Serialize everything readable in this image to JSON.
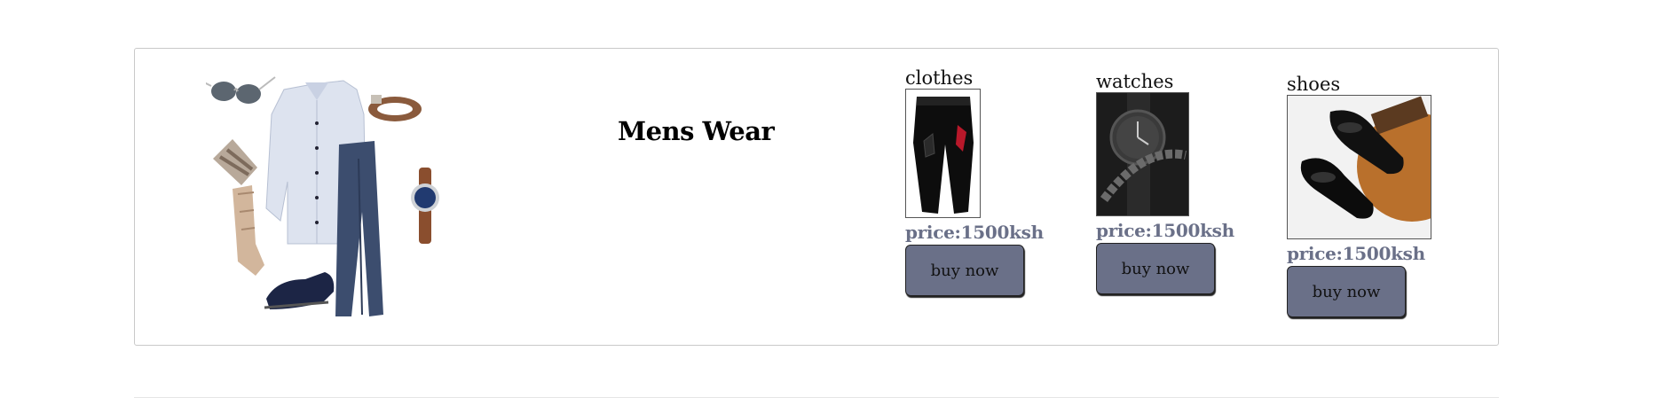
{
  "section": {
    "title": "Mens Wear"
  },
  "products": [
    {
      "name": "clothes",
      "price": "price:1500ksh",
      "button": "buy now",
      "image_icon": "cargo-pants-image"
    },
    {
      "name": "watches",
      "price": "price:1500ksh",
      "button": "buy now",
      "image_icon": "watch-bracelet-image"
    },
    {
      "name": "shoes",
      "price": "price:1500ksh",
      "button": "buy now",
      "image_icon": "dress-shoes-image"
    }
  ],
  "colors": {
    "accent": "#6a7088",
    "border": "#c9c9c9"
  }
}
